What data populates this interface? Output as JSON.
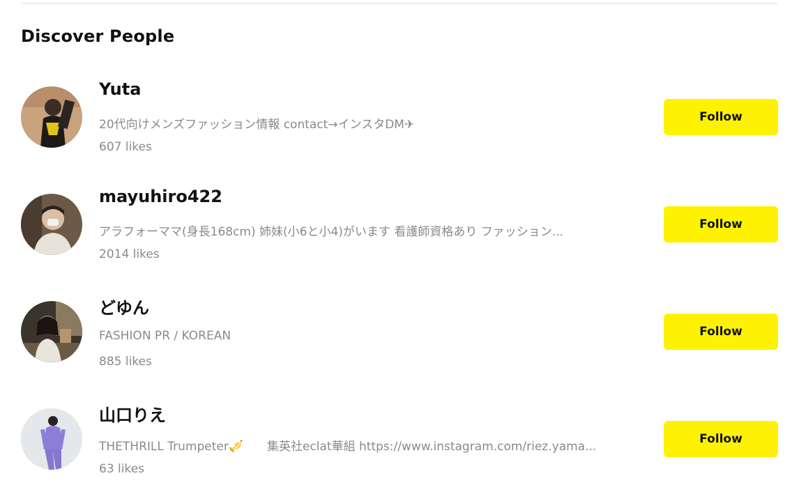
{
  "section": {
    "title": "Discover People"
  },
  "users": [
    {
      "name": "Yuta",
      "bio": "20代向けメンズファッション情報 contact→インスタDM✈",
      "likes": "607 likes",
      "follow_label": "Follow",
      "avatar_icon": "avatar-photo"
    },
    {
      "name": "mayuhiro422",
      "bio": "アラフォーママ(身長168cm) 姉妹(小6と小4)がいます 看護師資格あり ファッション...",
      "likes": "2014 likes",
      "follow_label": "Follow",
      "avatar_icon": "avatar-photo"
    },
    {
      "name": "どゆん",
      "bio": "FASHION PR / KOREAN",
      "likes": "885 likes",
      "follow_label": "Follow",
      "avatar_icon": "avatar-photo"
    },
    {
      "name": "山口りえ",
      "bio": "THETHRILL Trumpeter🎺　　集英社eclat華組 https://www.instagram.com/riez.yama...",
      "likes": "63 likes",
      "follow_label": "Follow",
      "avatar_icon": "avatar-photo"
    }
  ],
  "colors": {
    "follow_button": "#fff200",
    "secondary_text": "#8a8a8a",
    "primary_text": "#111111"
  }
}
